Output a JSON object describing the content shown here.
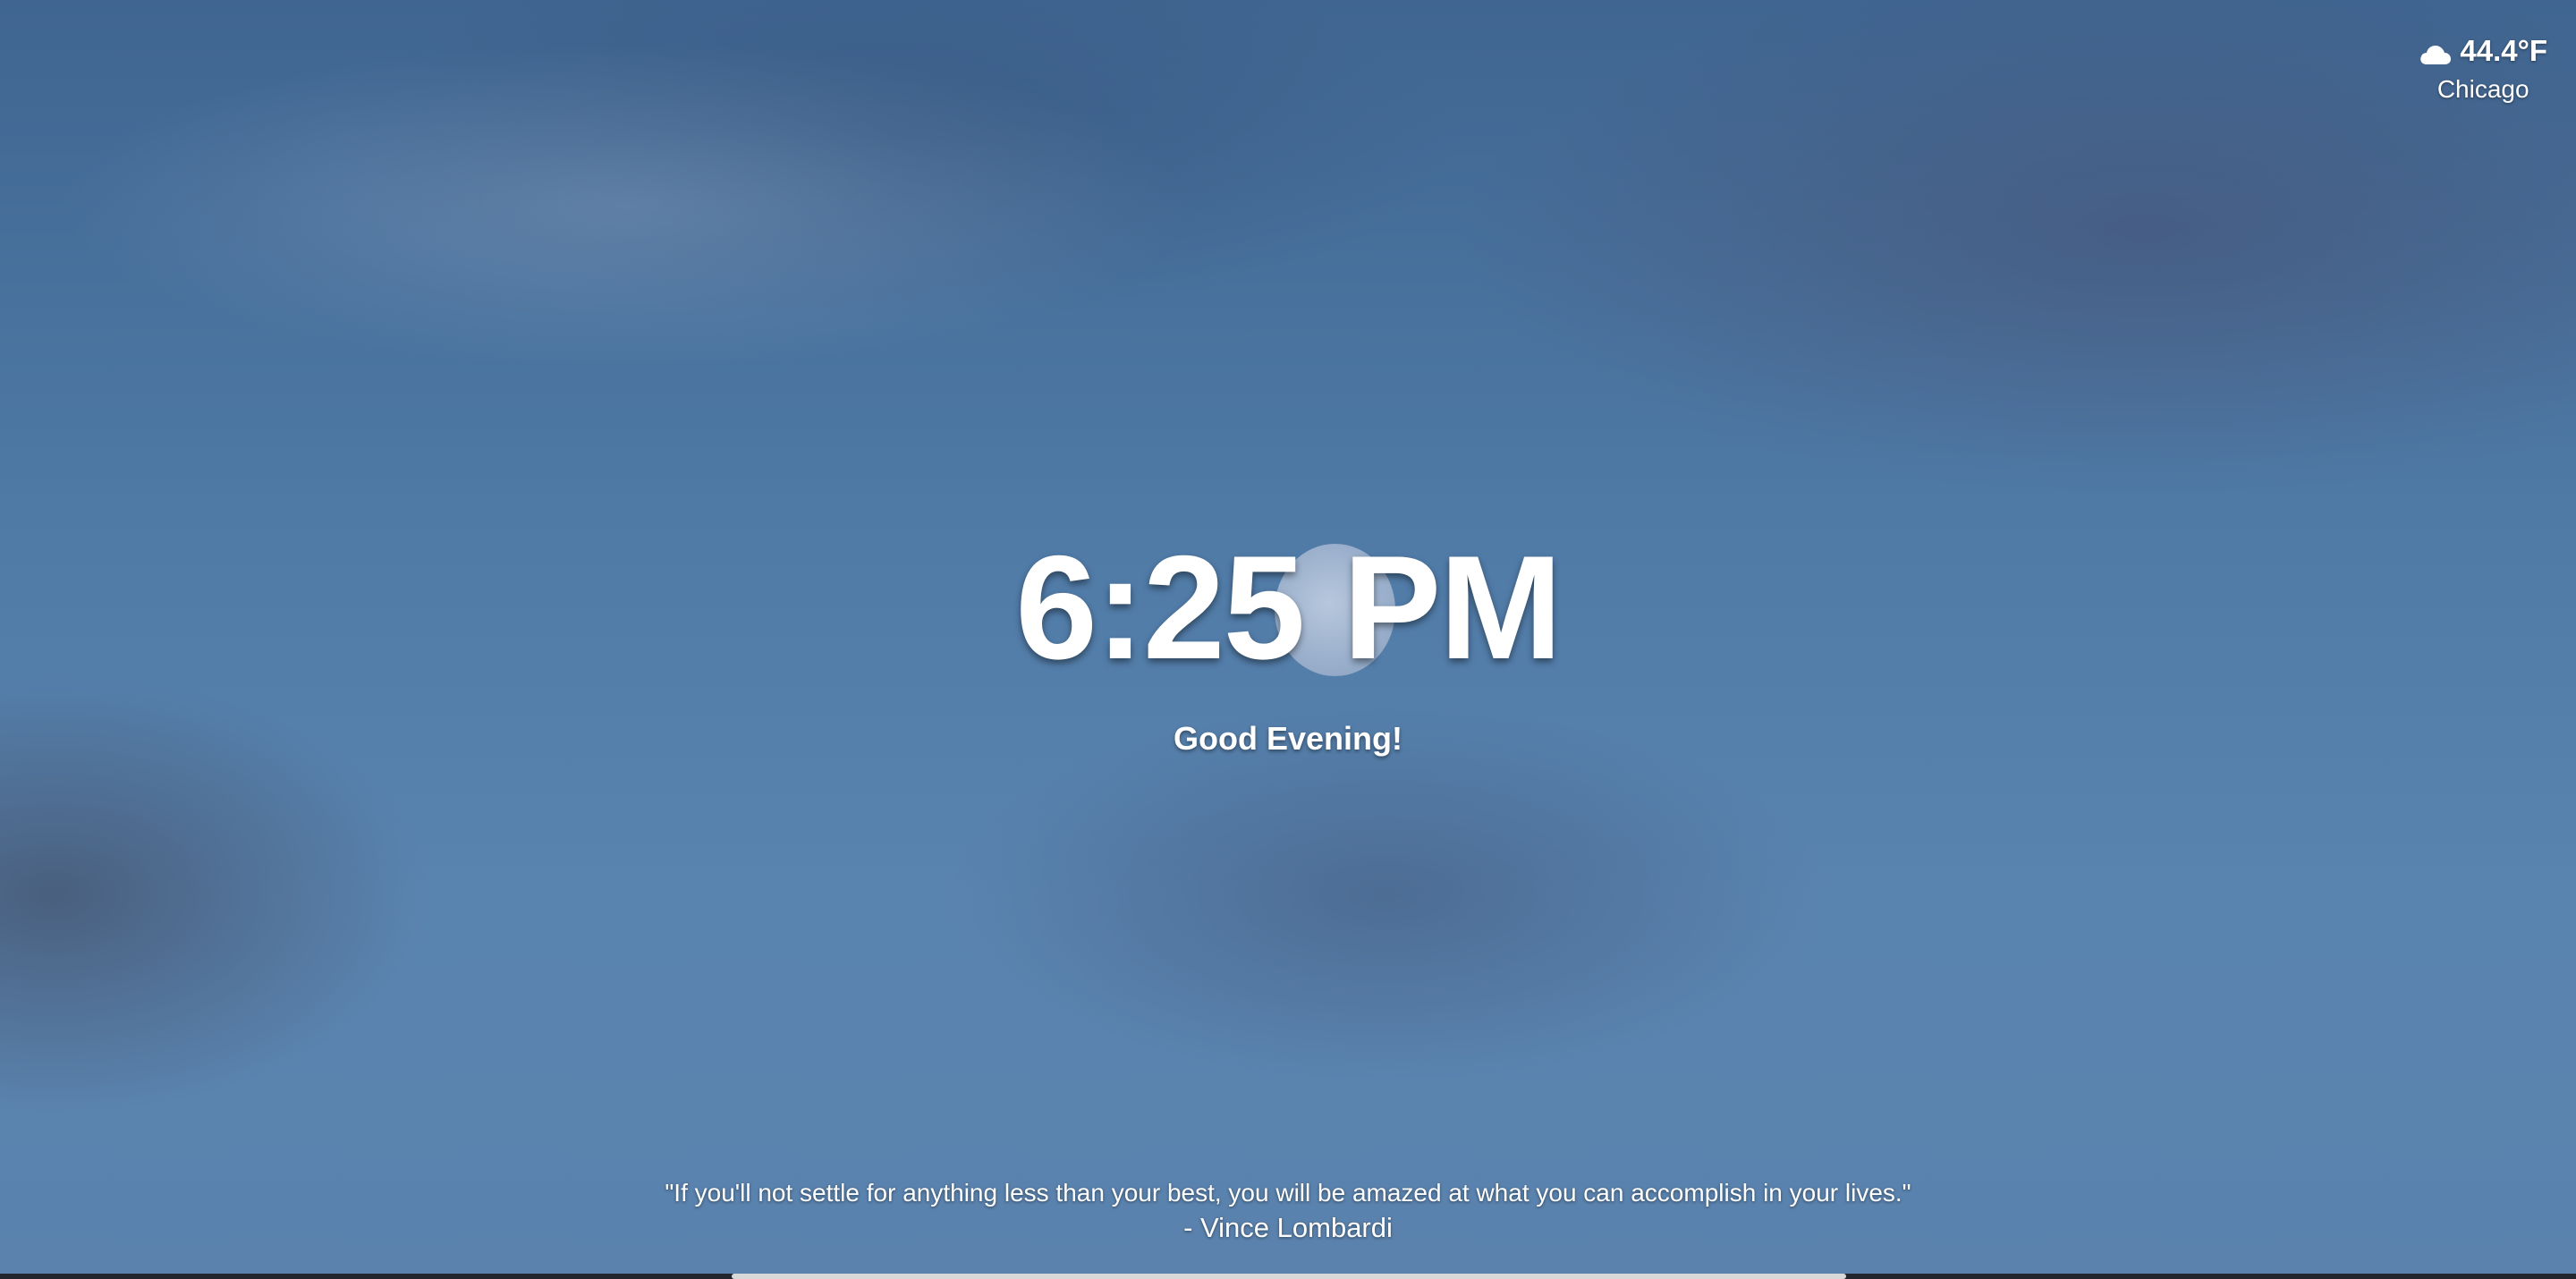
{
  "weather": {
    "icon": "cloud-icon",
    "temperature": "44.4°F",
    "city": "Chicago"
  },
  "clock": {
    "time": "6:25 PM",
    "greeting": "Good Evening!"
  },
  "quote": {
    "text": "\"If you'll not settle for anything less than your best, you will be amazed at what you can accomplish in your lives.\"",
    "author": "- Vince Lombardi"
  },
  "colors": {
    "text": "#ffffff",
    "sky": "#5a84b0"
  }
}
